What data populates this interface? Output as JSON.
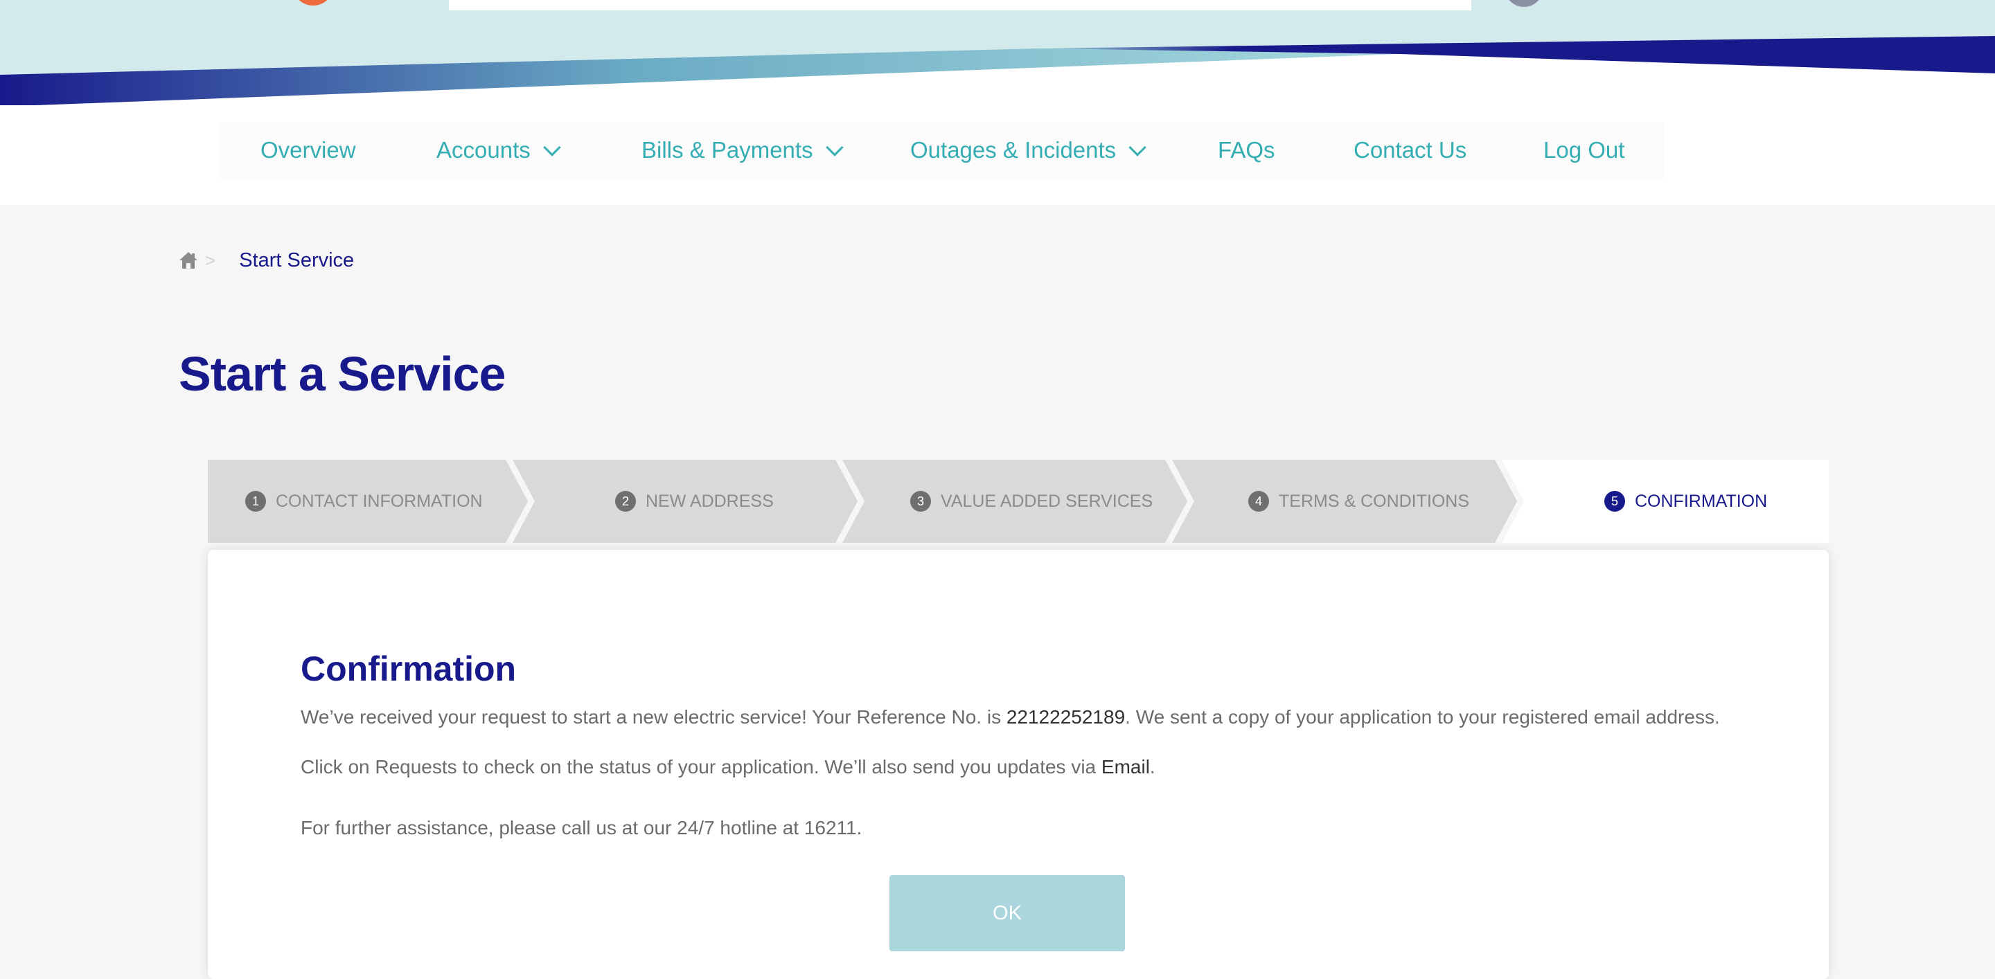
{
  "header": {
    "logo_icon": "brand-logo",
    "avatar_icon": "user-avatar-icon",
    "colors": {
      "banner_light": "#d3eaec",
      "banner_dark": "#181a8b",
      "banner_teal": "#8bcbd2",
      "logo_orange": "#ef6a3c"
    }
  },
  "nav": {
    "items": [
      {
        "label": "Overview",
        "has_dropdown": false
      },
      {
        "label": "Accounts",
        "has_dropdown": true
      },
      {
        "label": "Bills & Payments",
        "has_dropdown": true
      },
      {
        "label": "Outages & Incidents",
        "has_dropdown": true
      },
      {
        "label": "FAQs",
        "has_dropdown": false
      },
      {
        "label": "Contact Us",
        "has_dropdown": false
      },
      {
        "label": "Log Out",
        "has_dropdown": false
      }
    ],
    "color": "#34adb3"
  },
  "breadcrumb": {
    "home_icon": "home-icon",
    "separator": ">",
    "current": "Start Service"
  },
  "page": {
    "title": "Start a Service"
  },
  "stepper": {
    "steps": [
      {
        "number": "1",
        "label": "CONTACT INFORMATION",
        "state": "done"
      },
      {
        "number": "2",
        "label": "NEW ADDRESS",
        "state": "done"
      },
      {
        "number": "3",
        "label": "VALUE ADDED SERVICES",
        "state": "done"
      },
      {
        "number": "4",
        "label": "TERMS & CONDITIONS",
        "state": "done"
      },
      {
        "number": "5",
        "label": "CONFIRMATION",
        "state": "active"
      }
    ]
  },
  "confirmation": {
    "title": "Confirmation",
    "line1_prefix": "We’ve received your request to start a new electric service! Your Reference No. is ",
    "reference_no": "22122252189",
    "line1_suffix": ". We sent a copy of your application to your registered email address.",
    "line2_prefix": "Click on Requests to check on the status of your application. We’ll also send you updates via ",
    "channel": "Email",
    "line2_suffix": ".",
    "line3": "For further assistance, please call us at our 24/7 hotline at 16211.",
    "ok_label": "OK"
  }
}
